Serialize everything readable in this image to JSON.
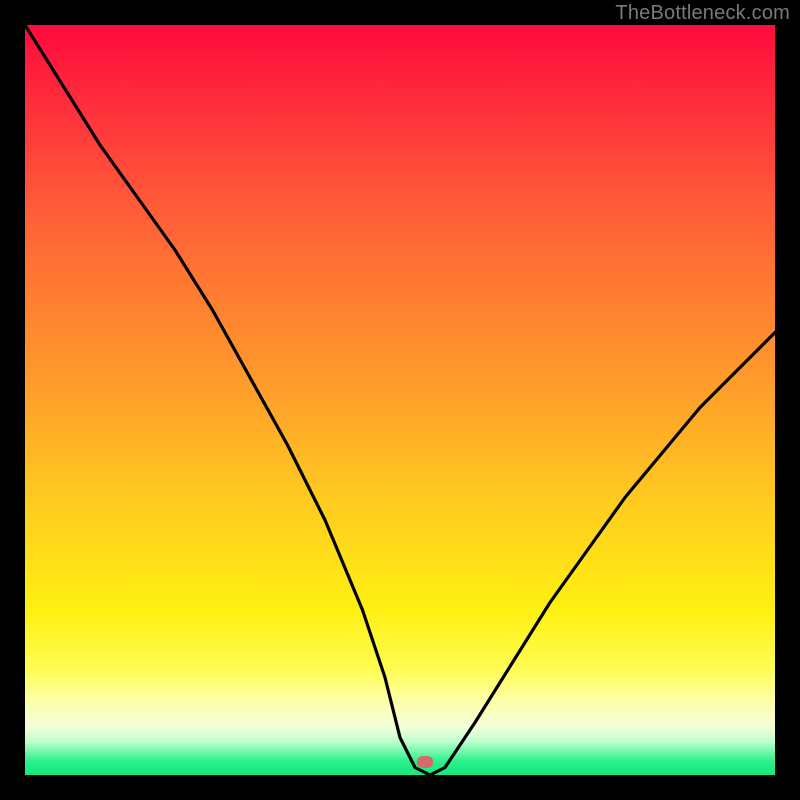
{
  "watermark": "TheBottleneck.com",
  "marker": {
    "x_pct": 53.3,
    "y_pct": 98.3
  },
  "chart_data": {
    "type": "line",
    "title": "",
    "xlabel": "",
    "ylabel": "",
    "xlim": [
      0,
      100
    ],
    "ylim": [
      0,
      100
    ],
    "series": [
      {
        "name": "bottleneck-curve",
        "x": [
          0,
          5,
          10,
          15,
          20,
          25,
          30,
          35,
          40,
          45,
          48,
          50,
          52,
          54,
          56,
          60,
          65,
          70,
          75,
          80,
          85,
          90,
          95,
          100
        ],
        "values": [
          100,
          92,
          84,
          77,
          70,
          62,
          53,
          44,
          34,
          22,
          13,
          5,
          1,
          0,
          1,
          7,
          15,
          23,
          30,
          37,
          43,
          49,
          54,
          59
        ]
      }
    ],
    "marker_point": {
      "x": 53.3,
      "y": 1.7
    },
    "gradient_stops": [
      {
        "pos": 0,
        "color": "#ff0a3c"
      },
      {
        "pos": 10,
        "color": "#ff2c3c"
      },
      {
        "pos": 22,
        "color": "#ff5539"
      },
      {
        "pos": 35,
        "color": "#ff7a32"
      },
      {
        "pos": 50,
        "color": "#ffa22a"
      },
      {
        "pos": 65,
        "color": "#ffcf1e"
      },
      {
        "pos": 78,
        "color": "#fff011"
      },
      {
        "pos": 86,
        "color": "#fffd55"
      },
      {
        "pos": 90,
        "color": "#fdffa6"
      },
      {
        "pos": 93.5,
        "color": "#f4ffd8"
      },
      {
        "pos": 95.5,
        "color": "#bfffcf"
      },
      {
        "pos": 97,
        "color": "#6cf7a9"
      },
      {
        "pos": 98.2,
        "color": "#2af088"
      },
      {
        "pos": 100,
        "color": "#13e97e"
      }
    ]
  }
}
